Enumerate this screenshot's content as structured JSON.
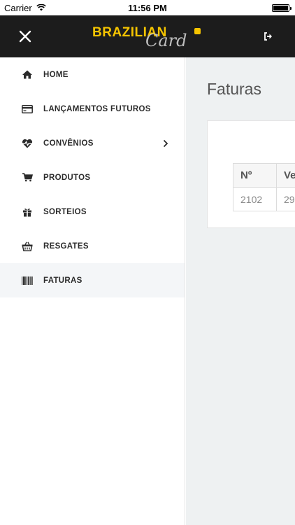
{
  "status_bar": {
    "carrier": "Carrier",
    "time": "11:56 PM"
  },
  "header": {
    "logo_brand": "BRAZILIAN",
    "logo_card": "Card"
  },
  "sidebar": {
    "items": [
      {
        "label": "HOME",
        "icon": "home-icon"
      },
      {
        "label": "LANÇAMENTOS FUTUROS",
        "icon": "credit-card-icon"
      },
      {
        "label": "CONVÊNIOS",
        "icon": "heartbeat-icon",
        "has_submenu": true
      },
      {
        "label": "PRODUTOS",
        "icon": "cart-icon"
      },
      {
        "label": "SORTEIOS",
        "icon": "gift-icon"
      },
      {
        "label": "RESGATES",
        "icon": "basket-icon"
      },
      {
        "label": "FATURAS",
        "icon": "barcode-icon",
        "active": true
      }
    ]
  },
  "main": {
    "title": "Faturas",
    "table": {
      "headers": [
        "Nº",
        "Ve"
      ],
      "rows": [
        [
          "2102",
          "29."
        ]
      ]
    }
  },
  "colors": {
    "header_bg": "#1c1c1c",
    "brand_yellow": "#f5c400",
    "content_bg": "#eef1f2",
    "active_item_bg": "#f4f6f8"
  }
}
